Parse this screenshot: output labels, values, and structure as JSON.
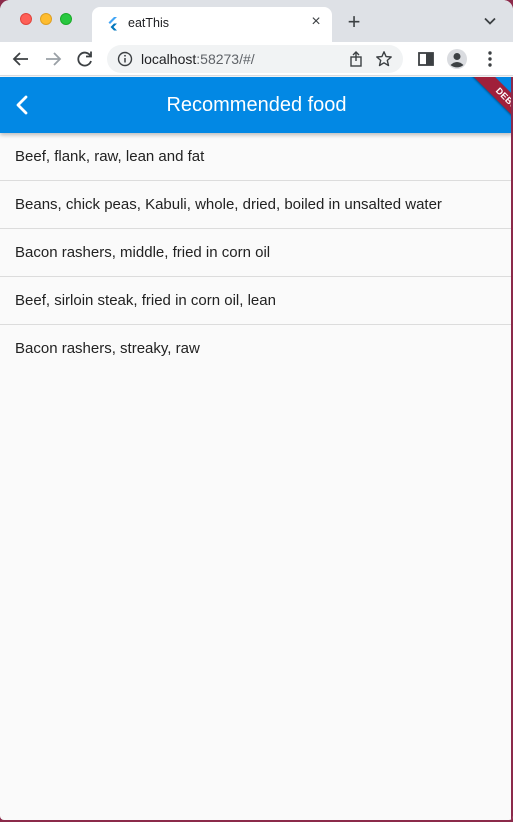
{
  "browser": {
    "tab": {
      "title": "eatThis",
      "close": "×"
    },
    "new_tab": "+",
    "address": {
      "host": "localhost",
      "rest": ":58273/#/"
    }
  },
  "app": {
    "title": "Recommended food",
    "debug_banner": "DEBUG",
    "accent_color": "#0288e4",
    "items": [
      "Beef, flank, raw, lean and fat",
      "Beans, chick peas, Kabuli, whole, dried, boiled in unsalted water",
      "Bacon rashers, middle, fried in corn oil",
      "Beef, sirloin steak, fried in corn oil, lean",
      "Bacon rashers, streaky, raw"
    ]
  }
}
